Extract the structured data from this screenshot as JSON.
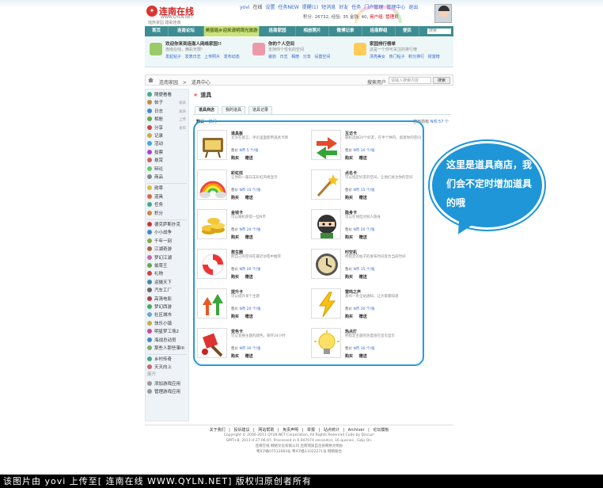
{
  "header": {
    "logo_name": "连南在线",
    "logo_url": "WWW.QYLN.NET",
    "logo_tag": "瑶族家园 踏歌连南",
    "user": "yovi",
    "online": "在线",
    "settings": "设置",
    "task_new": "任务NEW",
    "messages": "提醒(1)",
    "message_center": "短消息",
    "friends": "好友",
    "tasks": "任务",
    "portal": "门户管理",
    "admin_center": "管理中心",
    "logout": "退出",
    "credits_label": "积分: 26732",
    "credits_rest": ", 经验: 35",
    "gold": "金钱: 40",
    "group": ", 用户组: 管理员"
  },
  "nav": {
    "items": [
      "首页",
      "连南论坛",
      "美丽瑶乡迎来清明观光旅游",
      "连南家园",
      "相册照片",
      "微博记录",
      "连南群组",
      "便民"
    ],
    "search_placeholder": "搜索"
  },
  "promo": [
    {
      "title": "欢迎你来到连南人网络家园!!",
      "sub": "连南在线，精彩无限!",
      "links": "发起帖子  发表日志  上传照片  发布动态"
    },
    {
      "title": "你的个人空间",
      "sub": "支持你个性化的空间",
      "links": "装扮  日志  相册  分享  设置空间"
    },
    {
      "title": "家园排行榜单",
      "sub": "这是一个你可关注的排行榜",
      "links": "漂亮美女  热门帖子  积分排行  财富榜"
    }
  ],
  "crumb": {
    "path": "连南家园  >  道具中心",
    "search_label": "搜索用户",
    "search_placeholder": "请输入搜索内容",
    "search_button": "搜索"
  },
  "sidebar": {
    "items": [
      {
        "label": "随便看看",
        "extra": "",
        "color": "#4a8"
      },
      {
        "label": "帖子",
        "extra": "发表",
        "color": "#c84"
      },
      {
        "label": "日志",
        "extra": "发表",
        "color": "#48c"
      },
      {
        "label": "相册",
        "extra": "上传",
        "color": "#6a4"
      },
      {
        "label": "分享",
        "extra": "发布",
        "color": "#c44"
      },
      {
        "label": "记录",
        "extra": "",
        "color": "#ca4"
      },
      {
        "label": "活动",
        "extra": "",
        "color": "#4ac"
      },
      {
        "label": "投票",
        "extra": "",
        "color": "#a4c"
      },
      {
        "label": "悬赏",
        "extra": "",
        "color": "#c66"
      },
      {
        "label": "辩论",
        "extra": "",
        "color": "#6c6"
      },
      {
        "label": "商品",
        "extra": "",
        "color": "#888"
      },
      {
        "label": "勋章",
        "extra": "",
        "color": "#db4"
      },
      {
        "label": "道具",
        "extra": "",
        "color": "#d64"
      },
      {
        "label": "任务",
        "extra": "",
        "color": "#4a8"
      },
      {
        "label": "积分",
        "extra": "",
        "color": "#c84"
      },
      {
        "label": "德克萨斯扑克",
        "extra": "",
        "color": "#c33"
      },
      {
        "label": "小小战争",
        "extra": "",
        "color": "#48c"
      },
      {
        "label": "千年一刻",
        "extra": "",
        "color": "#8a4"
      },
      {
        "label": "江湖奇游",
        "extra": "",
        "color": "#a64"
      },
      {
        "label": "梦幻江湖",
        "extra": "",
        "color": "#c6a"
      },
      {
        "label": "偷菜王",
        "extra": "",
        "color": "#6a4"
      },
      {
        "label": "礼物",
        "extra": "",
        "color": "#c44"
      },
      {
        "label": "运输天下",
        "extra": "",
        "color": "#48a"
      },
      {
        "label": "汽车工厂",
        "extra": "",
        "color": "#666"
      },
      {
        "label": "高清电影",
        "extra": "",
        "color": "#a44"
      },
      {
        "label": "梦幻西游",
        "extra": "",
        "color": "#4a6"
      },
      {
        "label": "社区城市",
        "extra": "",
        "color": "#6ac"
      },
      {
        "label": "快乐小镇",
        "extra": "",
        "color": "#ca4"
      },
      {
        "label": "明星梦工场2",
        "extra": "",
        "color": "#c4a"
      },
      {
        "label": "海战总动员",
        "extra": "",
        "color": "#48c"
      },
      {
        "label": "那些人那些事III",
        "extra": "",
        "color": "#8a6"
      },
      {
        "label": "乡村传奇",
        "extra": "",
        "color": "#4a8"
      },
      {
        "label": "天天向上",
        "extra": "",
        "color": "#c66"
      },
      {
        "label": "添加游戏应用",
        "extra": "",
        "color": "#999"
      },
      {
        "label": "管理游戏应用",
        "extra": "",
        "color": "#999"
      }
    ],
    "more": "展开"
  },
  "main": {
    "title": "道具",
    "tabs": [
      "道具商店",
      "我的道具",
      "道具记录"
    ],
    "sort": [
      "默认",
      "热门"
    ],
    "money_label": "您目前有",
    "money_value": "N币 57 个"
  },
  "items": [
    {
      "name": "道具板",
      "desc": "允许在留言、评论里面使用道具卡牌",
      "price_label": "售价",
      "price": "N币 5 个/张",
      "buy": "购买",
      "gift": "赠送",
      "icon": "signboard-icon"
    },
    {
      "name": "互访卡",
      "desc": "随机选择20个好友，在半个钟内，留意你的空间",
      "price_label": "售价",
      "price": "N币 10 个/张",
      "buy": "购买",
      "gift": "赠送",
      "icon": "swap-arrows-icon"
    },
    {
      "name": "彩虹炫",
      "desc": "让你的一篇日志彩虹风格显示",
      "price_label": "售价",
      "price": "N币 15 个/张",
      "buy": "购买",
      "gift": "赠送",
      "icon": "rainbow-icon"
    },
    {
      "name": "点名卡",
      "desc": "可以指定好友的空间，让他们关注你的空间",
      "price_label": "售价",
      "price": "N币 15 个/张",
      "buy": "购买",
      "gift": "赠送",
      "icon": "magic-wand-icon"
    },
    {
      "name": "金钱卡",
      "desc": "可以随机获得一些N币",
      "price_label": "售价",
      "price": "N币 20 个/张",
      "buy": "购买",
      "gift": "赠送",
      "icon": "gold-coins-icon"
    },
    {
      "name": "隐身卡",
      "desc": "可以在线但对别人隐身",
      "price_label": "售价",
      "price": "N币 20 个/张",
      "buy": "购买",
      "gift": "赠送",
      "icon": "ninja-icon"
    },
    {
      "name": "救生圈",
      "desc": "把自己的空间在最近访客中推荐",
      "price_label": "售价",
      "price": "N币 20 个/张",
      "buy": "购买",
      "gift": "赠送",
      "icon": "life-ring-icon"
    },
    {
      "name": "时空机",
      "desc": "把指定的帖子的发布时间变为当前时间",
      "price_label": "售价",
      "price": "N币 15 个/张",
      "buy": "购买",
      "gift": "赠送",
      "icon": "time-machine-icon"
    },
    {
      "name": "提升卡",
      "desc": "可以提升某个主题",
      "price_label": "售价",
      "price": "N币 20 个/张",
      "buy": "购买",
      "gift": "赠送",
      "icon": "up-arrows-icon"
    },
    {
      "name": "雷鸣之声",
      "desc": "发布一条全站通知，让大家都知道",
      "price_label": "售价",
      "price": "N币 20 个/张",
      "buy": "购买",
      "gift": "赠送",
      "icon": "lightning-icon"
    },
    {
      "name": "变色卡",
      "desc": "可以变换主题的颜色，保存24小时",
      "price_label": "售价",
      "price": "N币 30 个/张",
      "buy": "购买",
      "gift": "赠送",
      "icon": "paint-brush-icon"
    },
    {
      "name": "热点灯",
      "desc": "把指定主题的热度值在首页显示",
      "price_label": "售价",
      "price": "N币 30 个/张",
      "buy": "购买",
      "gift": "赠送",
      "icon": "light-bulb-icon"
    }
  ],
  "bubble": {
    "text": "这里是道具商店，我们会不定时增加道具的哦"
  },
  "footer": {
    "links": "关于我们 | 投诉建议 | 网站帮助 | 免责声明 | 举报 | 站点统计 | Archiver | 论坛模板",
    "line1": "Copyright © 2006-2011 QYLN.NET Corporation, All Rights Reserved Code by Discuz!",
    "line2": "GMT+8, 2011-4-27 06:47, Processed in 0.047074 second(s), 16 queries , Gzip On.",
    "line3": "连南在线 网络文化有限公司 连南瑶族自治县网络文明办",
    "line4": "粤ICP备07512683号 粤ICP备11022271号 网络联合"
  },
  "caption": "该图片由 yovi 上传至[ 连南在线 WWW.QYLN.NET] 版权归原创者所有"
}
